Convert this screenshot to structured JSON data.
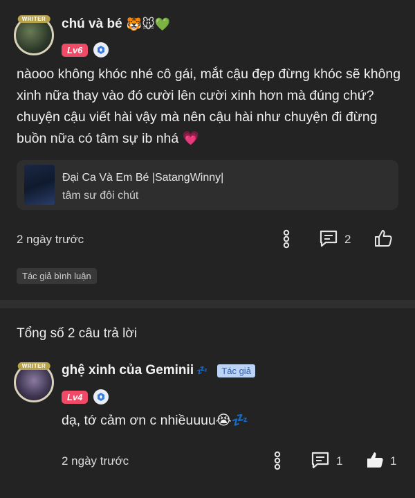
{
  "comment": {
    "avatar_badge": "WRITER",
    "username": "chú và bé",
    "username_emojis": "🐯🐭💚",
    "level": "Lv6",
    "text": "nàooo không khóc nhé cô gái, mắt cậu đẹp đừng khóc sẽ không xinh nữa thay vào đó cười lên cười xinh hơn mà đúng chứ? chuyện cậu viết hài vậy mà nên cậu hài như chuyện đi đừng buồn nữa có tâm sự ib nhá 💗",
    "quote": {
      "title": "Đại Ca Và Em Bé |SatangWinny|",
      "chapter": "tâm sư đôi chút"
    },
    "time": "2 ngày trước",
    "reply_count": "2",
    "tag": "Tác giả bình luận"
  },
  "replies_header": "Tổng số 2 câu trả lời",
  "reply": {
    "avatar_badge": "WRITER",
    "username": "ghệ xinh của Geminii",
    "username_emojis": "💤",
    "author_tag": "Tác giả",
    "level": "Lv4",
    "text": "dạ, tớ cảm ơn c nhiềuuuu😭💤",
    "time": "2 ngày trước",
    "reply_count": "1",
    "like_count": "1"
  },
  "colors": {
    "background": "#232323",
    "level_badge": "#f14a66",
    "author_tag_bg": "#bcd3f6",
    "author_tag_text": "#2b5fb3"
  }
}
